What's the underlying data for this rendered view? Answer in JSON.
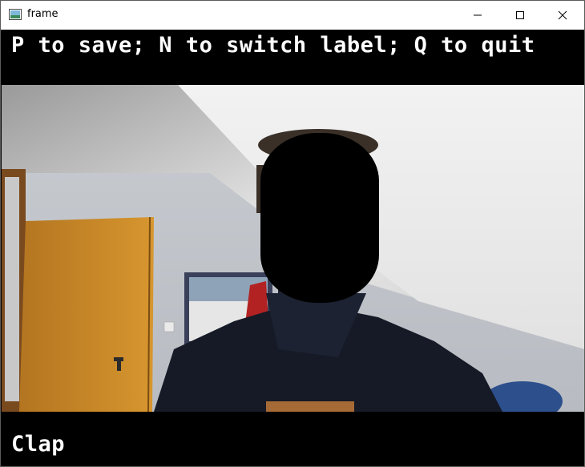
{
  "window": {
    "title": "frame",
    "icons": {
      "app": "app-icon",
      "minimize": "minimize-icon",
      "maximize": "maximize-icon",
      "close": "close-icon"
    }
  },
  "overlay": {
    "instructions": "P to save; N to switch label; Q to quit",
    "current_label": "Clap"
  },
  "colors": {
    "overlay_bar": "#000000",
    "overlay_text": "#ffffff",
    "face_mask": "#000000"
  }
}
